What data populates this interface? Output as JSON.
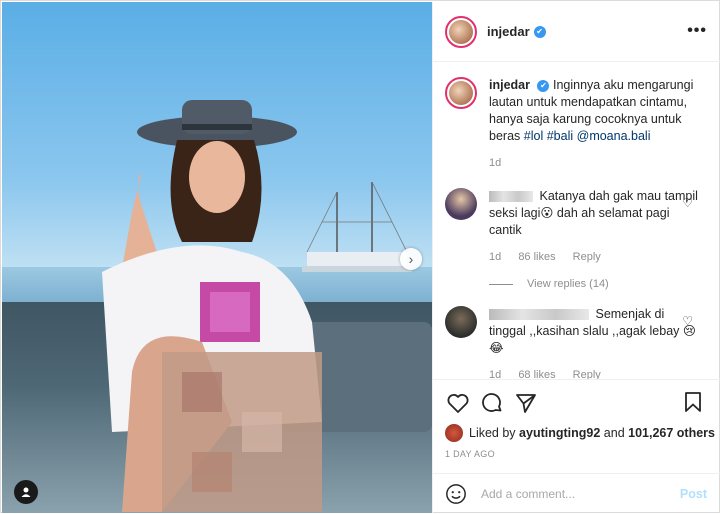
{
  "post": {
    "author": "injedar",
    "verified_mark": "✔",
    "more_glyph": "•••"
  },
  "caption": {
    "author": "injedar",
    "text": "Inginnya aku mengarungi lautan untuk mendapatkan cintamu, hanya saja karung cocoknya untuk beras",
    "tags": [
      "#lol",
      "#bali",
      "@moana.bali"
    ],
    "time": "1d"
  },
  "comments": [
    {
      "text": "Katanya dah gak mau tampil seksi lagi😮 dah ah selamat pagi cantik",
      "time": "1d",
      "likes": "86 likes",
      "reply": "Reply",
      "view_replies": "View replies (14)"
    },
    {
      "text": "Semenjak di tinggal ,,kasihan slalu ,,agak lebay 😢😂",
      "time": "1d",
      "likes": "68 likes",
      "reply": "Reply"
    }
  ],
  "likes": {
    "prefix": "Liked by",
    "user": "ayutingting92",
    "and": "and",
    "count": "101,267 others"
  },
  "date": "1 DAY AGO",
  "add_comment": {
    "placeholder": "Add a comment...",
    "post_label": "Post"
  },
  "nav": {
    "next_glyph": "›"
  },
  "colors": {
    "link": "#00376b",
    "verified": "#3897f0",
    "post_disabled": "#b2dffc",
    "story_ring": "#e1306c"
  },
  "icons": [
    "heart-icon",
    "comment-icon",
    "share-icon",
    "bookmark-icon",
    "emoji-icon",
    "user-tag-icon",
    "chevron-right-icon",
    "more-icon",
    "verified-icon"
  ]
}
